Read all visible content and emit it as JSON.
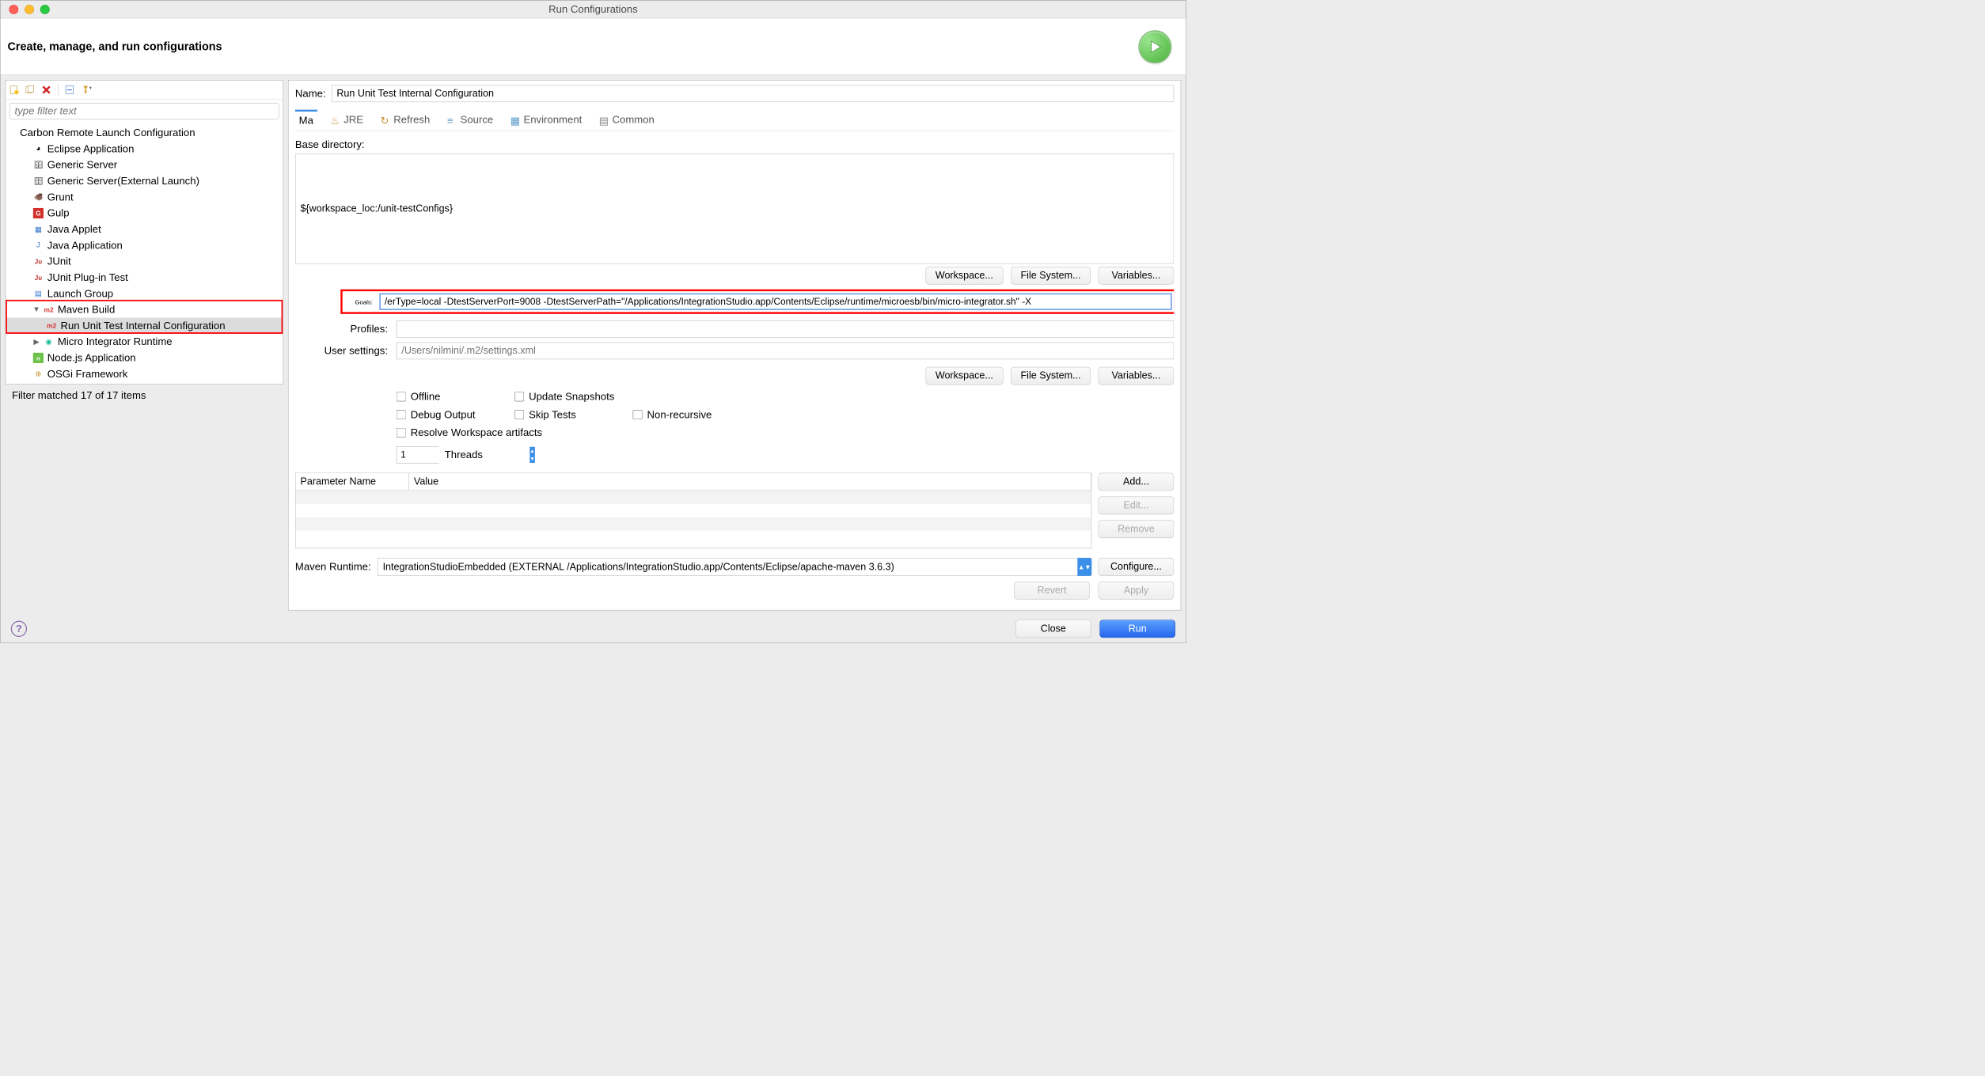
{
  "window": {
    "title": "Run Configurations"
  },
  "header": {
    "title": "Create, manage, and run configurations"
  },
  "toolbar": {
    "new": "New Configuration",
    "dup": "Duplicate",
    "del": "Delete",
    "collapse": "Collapse All",
    "filter": "Filter"
  },
  "filter_placeholder": "type filter text",
  "tree": [
    {
      "label": "Carbon Remote Launch Configuration",
      "icon": "carbon",
      "level": 1
    },
    {
      "label": "Eclipse Application",
      "icon": "eclipse",
      "level": 2
    },
    {
      "label": "Generic Server",
      "icon": "server",
      "level": 2
    },
    {
      "label": "Generic Server(External Launch)",
      "icon": "server",
      "level": 2
    },
    {
      "label": "Grunt",
      "icon": "grunt",
      "level": 2
    },
    {
      "label": "Gulp",
      "icon": "gulp",
      "level": 2
    },
    {
      "label": "Java Applet",
      "icon": "applet",
      "level": 2
    },
    {
      "label": "Java Application",
      "icon": "java",
      "level": 2
    },
    {
      "label": "JUnit",
      "icon": "junit",
      "level": 2
    },
    {
      "label": "JUnit Plug-in Test",
      "icon": "junit-plugin",
      "level": 2
    },
    {
      "label": "Launch Group",
      "icon": "group",
      "level": 2
    },
    {
      "label": "Maven Build",
      "icon": "maven",
      "level": 2,
      "expanded": true
    },
    {
      "label": "Run Unit Test Internal Configuration",
      "icon": "maven",
      "level": 3,
      "selected": true
    },
    {
      "label": "Micro Integrator Runtime",
      "icon": "micro",
      "level": 2,
      "arrow": true
    },
    {
      "label": "Node.js Application",
      "icon": "node",
      "level": 2
    },
    {
      "label": "OSGi Framework",
      "icon": "osgi",
      "level": 2
    }
  ],
  "filter_status": "Filter matched 17 of 17 items",
  "form": {
    "name_label": "Name:",
    "name_value": "Run Unit Test Internal Configuration"
  },
  "tabs": [
    {
      "label": "Ma",
      "icon": "maven",
      "active": true
    },
    {
      "label": "JRE",
      "icon": "jre"
    },
    {
      "label": "Refresh",
      "icon": "refresh"
    },
    {
      "label": "Source",
      "icon": "source"
    },
    {
      "label": "Environment",
      "icon": "env"
    },
    {
      "label": "Common",
      "icon": "common"
    }
  ],
  "main": {
    "base_dir_label": "Base directory:",
    "base_dir_value": "${workspace_loc:/unit-testConfigs}",
    "btn_workspace": "Workspace...",
    "btn_filesystem": "File System...",
    "btn_variables": "Variables...",
    "goals_label": "Goals:",
    "goals_value": "/erType=local -DtestServerPort=9008 -DtestServerPath=\"/Applications/IntegrationStudio.app/Contents/Eclipse/runtime/microesb/bin/micro-integrator.sh\" -X",
    "profiles_label": "Profiles:",
    "profiles_value": "",
    "user_settings_label": "User settings:",
    "user_settings_placeholder": "/Users/nilmini/.m2/settings.xml",
    "cb_offline": "Offline",
    "cb_update": "Update Snapshots",
    "cb_debug": "Debug Output",
    "cb_skip": "Skip Tests",
    "cb_nonrec": "Non-recursive",
    "cb_resolve": "Resolve Workspace artifacts",
    "threads_value": "1",
    "threads_label": "Threads",
    "param_name_header": "Parameter Name",
    "param_value_header": "Value",
    "btn_add": "Add...",
    "btn_edit": "Edit...",
    "btn_remove": "Remove",
    "runtime_label": "Maven Runtime:",
    "runtime_value": "IntegrationStudioEmbedded (EXTERNAL /Applications/IntegrationStudio.app/Contents/Eclipse/apache-maven 3.6.3)",
    "btn_configure": "Configure..."
  },
  "footer": {
    "btn_revert": "Revert",
    "btn_apply": "Apply",
    "btn_close": "Close",
    "btn_run": "Run"
  }
}
